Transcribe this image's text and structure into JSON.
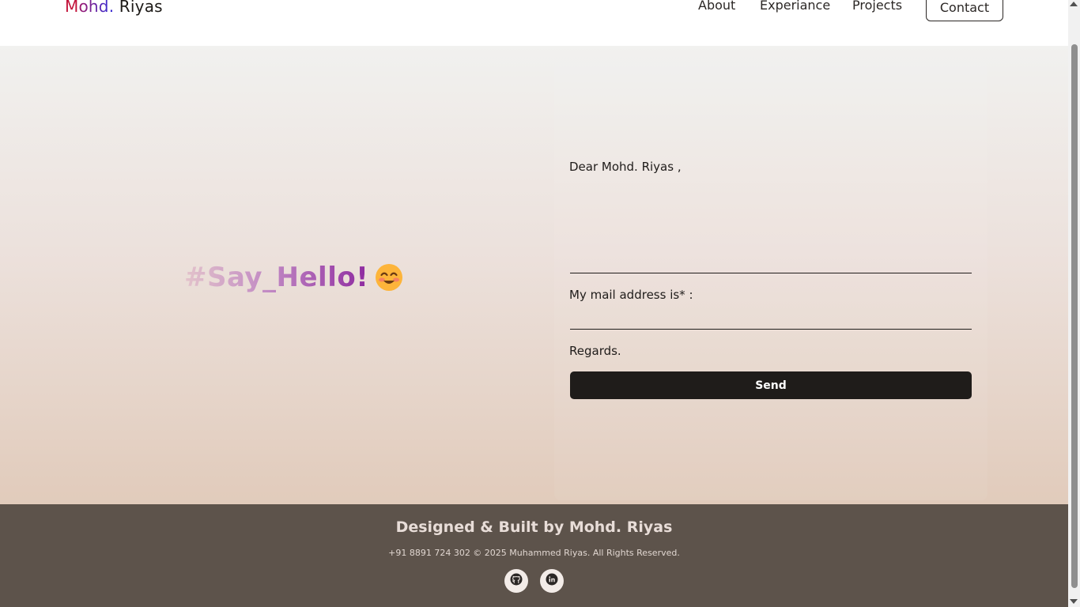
{
  "header": {
    "logo": {
      "first": "M",
      "middle": "ohd",
      "dot": ".",
      "last": " Riyas"
    },
    "nav": {
      "about": "About",
      "experience": "Experiance",
      "projects": "Projects",
      "contact": "Contact"
    }
  },
  "hero": {
    "greeting": "#Say_Hello!",
    "emoji_icon": "smiling-face-icon"
  },
  "form": {
    "salutation": "Dear Mohd. Riyas ,",
    "message_value": "",
    "mail_label": "My mail address is* :",
    "mail_value": "",
    "closing": "Regards.",
    "send_label": "Send"
  },
  "footer": {
    "title": "Designed & Built by Mohd. Riyas",
    "copyright": "+91 8891 724 302 © 2025 Muhammed Riyas. All Rights Reserved.",
    "socials": [
      {
        "icon": "github-icon"
      },
      {
        "icon": "linkedin-icon"
      }
    ]
  },
  "colors": {
    "logo_accent": "#c2123a",
    "button_bg": "#1f1c1a",
    "footer_bg": "#5d534b",
    "gradient_top": "#f1f1ef",
    "gradient_bottom": "#e1cbbb"
  }
}
